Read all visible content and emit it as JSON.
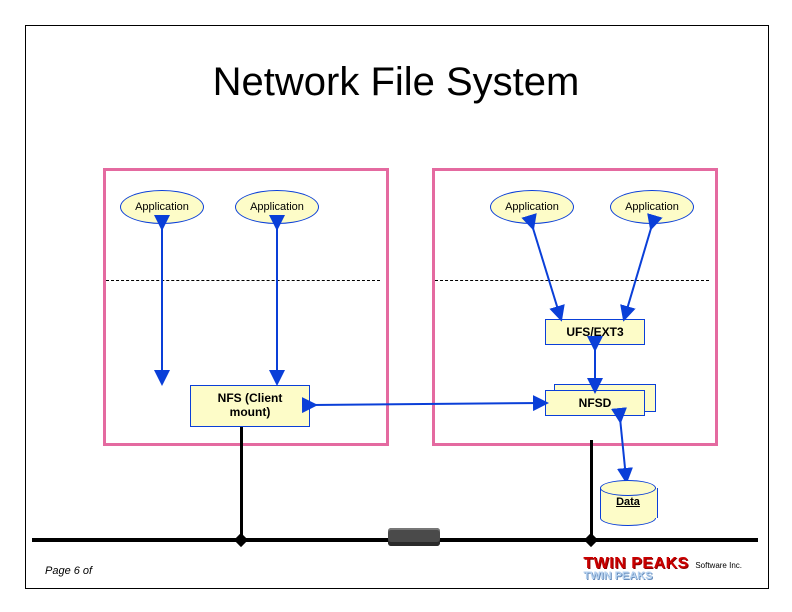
{
  "title": "Network File System",
  "apps": {
    "left1": "Application",
    "left2": "Application",
    "right1": "Application",
    "right2": "Application"
  },
  "boxes": {
    "ufs": "UFS/EXT3",
    "nfscli": "NFS (Client mount)",
    "nfsd": "NFSD"
  },
  "cylinder_label": "Data",
  "footer": {
    "page": "Page 6 of",
    "brand_top": "TWIN PEAKS",
    "brand_top_suffix": "Software Inc.",
    "brand_bottom": "TWIN PEAKS"
  }
}
